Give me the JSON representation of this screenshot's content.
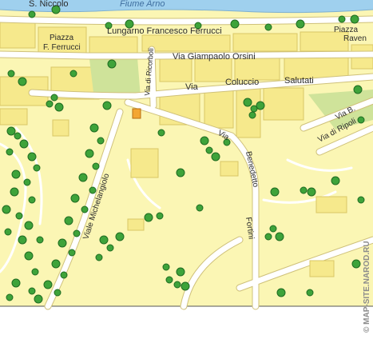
{
  "map": {
    "river_name": "Fiume Arno",
    "labels": {
      "s_niccolo": "S. Niccolo",
      "piazza_ferrucci_1": "Piazza",
      "piazza_ferrucci_2": "F. Ferrucci",
      "lungarno": "Lungarno Francesco Ferrucci",
      "piazza_right_1": "Piazza",
      "piazza_right_2": "Raven",
      "orsini": "Via Giampaolo Orsini",
      "ricorboli": "Via di Ricorboli",
      "via_coluccio": "Via",
      "coluccio": "Coluccio",
      "salutati": "Salutati",
      "via_b": "Via B.",
      "via_di_ripoli": "Via di Ripoli",
      "via_benedetto": "Via",
      "benedetto": "Benedetto",
      "fortini": "Fortini",
      "michelangiolo": "Viale Michelangiolo"
    },
    "watermark": "© MAP-SITE.NAROD.RU",
    "colors": {
      "land": "#fbf6b4",
      "block": "#f6e98c",
      "block_line": "#d9c766",
      "road": "#ffffff",
      "road_edge": "#cfc17a",
      "river": "#9fd0ee",
      "park": "#cfe39a",
      "tree": "#3ea33a",
      "tree_dark": "#1f6b21",
      "poi": "#f3a632"
    }
  }
}
